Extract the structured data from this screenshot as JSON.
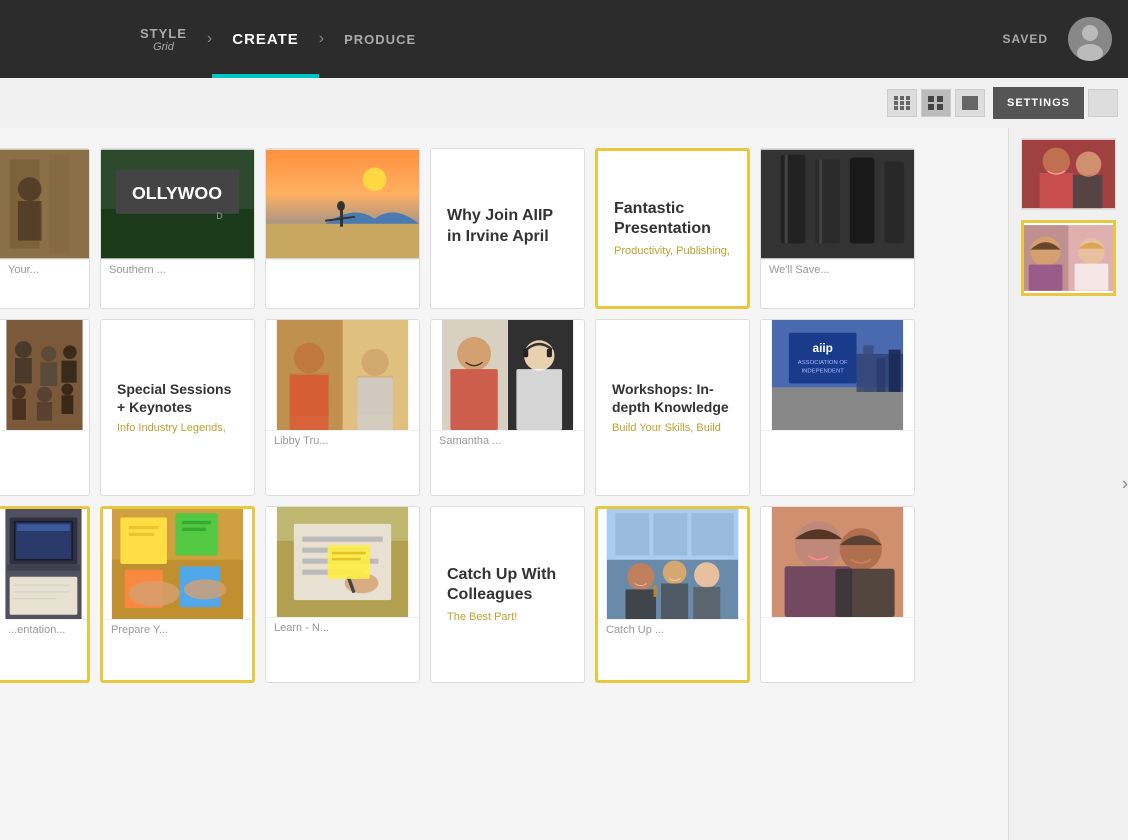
{
  "nav": {
    "style_label": "STYLE",
    "style_sub": "Grid",
    "create_label": "CREATE",
    "produce_label": "PRODUCE",
    "saved_label": "SAVED"
  },
  "toolbar": {
    "settings_label": "SETTINGS",
    "view_options": [
      "small-grid",
      "medium-grid",
      "large-grid"
    ]
  },
  "cards": {
    "row1": [
      {
        "id": "partial-wood",
        "type": "photo",
        "photo": "wood",
        "label": "Your...",
        "partial": true
      },
      {
        "id": "ollywood",
        "type": "photo",
        "photo": "sign",
        "label": "Southern ..."
      },
      {
        "id": "beach",
        "type": "photo",
        "photo": "beach",
        "label": ""
      },
      {
        "id": "why-join",
        "type": "text",
        "title": "Why Join AIIP in Irvine April",
        "subtitle": ""
      },
      {
        "id": "fantastic",
        "type": "text",
        "title": "Fantastic Presentation",
        "subtitle": "Productivity, Publishing,",
        "selected": true
      },
      {
        "id": "chairs",
        "type": "photo",
        "photo": "chairs",
        "label": "We'll Save..."
      }
    ],
    "row2": [
      {
        "id": "partial-crowd",
        "type": "photo",
        "photo": "crowd",
        "label": "",
        "partial": true
      },
      {
        "id": "special",
        "type": "text",
        "title": "Special Sessions + Keynotes",
        "subtitle": "Info Industry Legends,"
      },
      {
        "id": "libby",
        "type": "photo",
        "photo": "libby",
        "label": "Libby Tru..."
      },
      {
        "id": "samantha",
        "type": "photo",
        "photo": "samantha",
        "label": "Samantha ..."
      },
      {
        "id": "workshops",
        "type": "text",
        "title": "Workshops: In-depth Knowledge",
        "subtitle": "Build Your Skills, Build"
      },
      {
        "id": "aiip",
        "type": "photo",
        "photo": "aiip",
        "label": ""
      }
    ],
    "row3": [
      {
        "id": "partial-laptop",
        "type": "photo",
        "photo": "laptop",
        "label": "...entation...",
        "partial": true,
        "selected": true
      },
      {
        "id": "sticky",
        "type": "photo",
        "photo": "sticky",
        "label": "Prepare Y...",
        "selected": true
      },
      {
        "id": "learn",
        "type": "photo",
        "photo": "learn",
        "label": "Learn - N..."
      },
      {
        "id": "catch-up",
        "type": "text",
        "title": "Catch Up With Colleagues",
        "subtitle": "The Best Part!"
      },
      {
        "id": "catchup-photo",
        "type": "photo",
        "photo": "catchup",
        "label": "Catch Up ...",
        "selected": true
      },
      {
        "id": "couple",
        "type": "photo",
        "photo": "couple",
        "label": ""
      }
    ]
  },
  "sidebar_thumbs": [
    {
      "id": "thumb1",
      "photo": "sidebar1",
      "selected": false
    },
    {
      "id": "thumb2",
      "photo": "sidebar2",
      "selected": true
    }
  ]
}
